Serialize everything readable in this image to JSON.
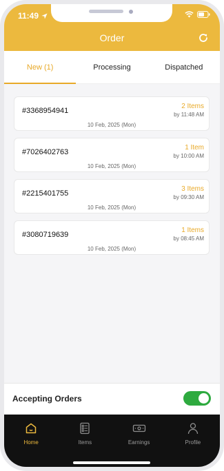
{
  "status_bar": {
    "time": "11:49",
    "location_icon": "location-arrow-icon",
    "wifi_icon": "wifi-icon",
    "battery_icon": "battery-icon"
  },
  "header": {
    "title": "Order",
    "refresh_icon": "refresh-icon",
    "color": "#ecb93e"
  },
  "tabs": [
    {
      "label": "New (1)",
      "active": true
    },
    {
      "label": "Processing",
      "active": false
    },
    {
      "label": "Dispatched",
      "active": false
    }
  ],
  "orders": [
    {
      "id": "#3368954941",
      "items": "2 Items",
      "by": "by 11:48 AM",
      "date": "10 Feb, 2025 (Mon)"
    },
    {
      "id": "#7026402763",
      "items": "1 Item",
      "by": "by 10:00 AM",
      "date": "10 Feb, 2025 (Mon)"
    },
    {
      "id": "#2215401755",
      "items": "3 Items",
      "by": "by 09:30 AM",
      "date": "10 Feb, 2025 (Mon)"
    },
    {
      "id": "#3080719639",
      "items": "1 Items",
      "by": "by 08:45 AM",
      "date": "10 Feb, 2025 (Mon)"
    }
  ],
  "accepting": {
    "label": "Accepting Orders",
    "enabled": true,
    "toggle_color": "#2eaa3f"
  },
  "nav": [
    {
      "label": "Home",
      "icon": "home-icon",
      "active": true
    },
    {
      "label": "Items",
      "icon": "list-icon",
      "active": false
    },
    {
      "label": "Earnings",
      "icon": "money-icon",
      "active": false
    },
    {
      "label": "Profile",
      "icon": "user-icon",
      "active": false
    }
  ],
  "accent_color": "#e8a928"
}
